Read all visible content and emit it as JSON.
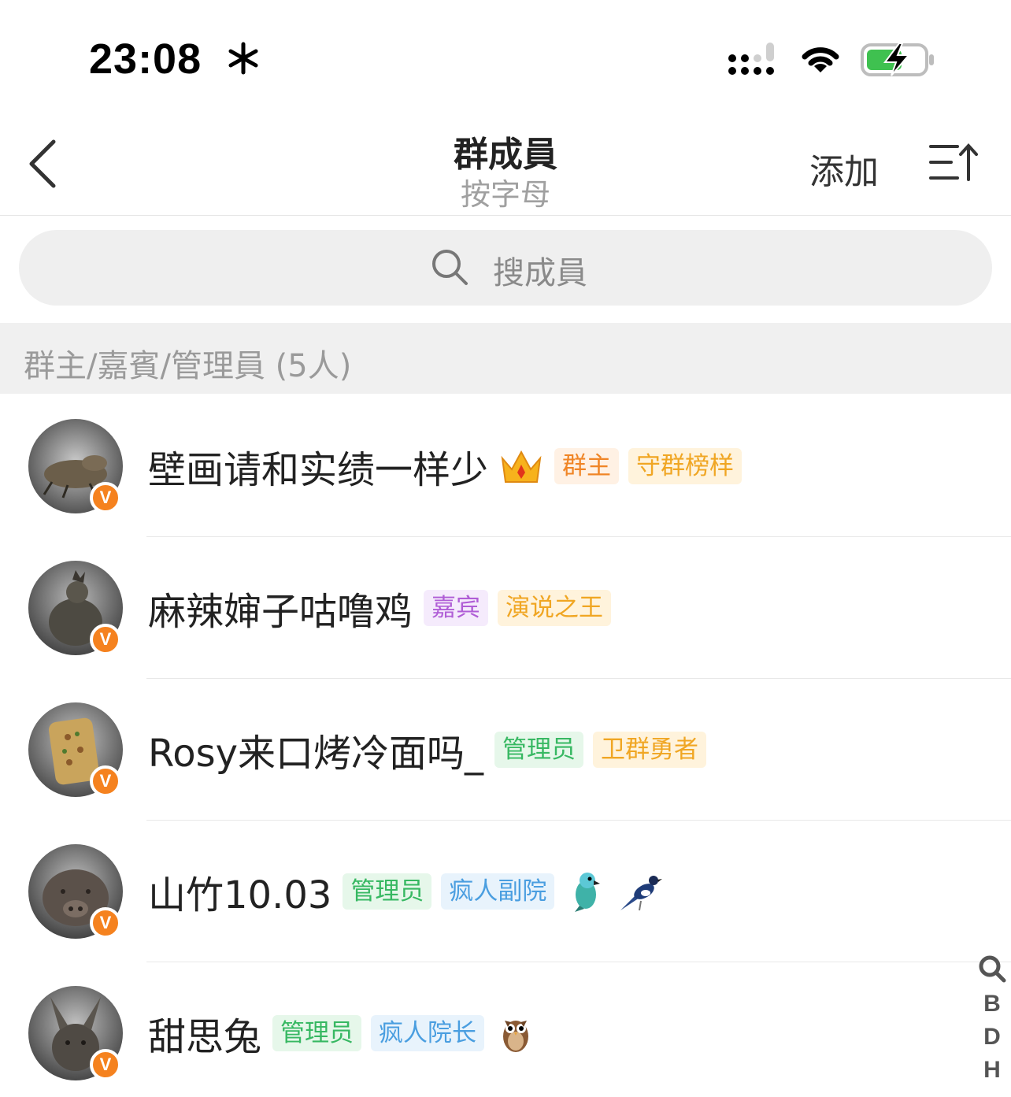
{
  "status_bar": {
    "time": "23:08"
  },
  "nav": {
    "title": "群成員",
    "subtitle": "按字母",
    "add_label": "添加"
  },
  "search": {
    "placeholder": "搜成員"
  },
  "section": {
    "title": "群主/嘉賓/管理員 (5人)"
  },
  "members": [
    {
      "name": "壁画请和实绩一样少",
      "tags": [
        "群主",
        "守群榜样"
      ],
      "icons": [
        "crown-icon"
      ]
    },
    {
      "name": "麻辣婶子咕噜鸡",
      "tags": [
        "嘉宾",
        "演说之王"
      ],
      "icons": []
    },
    {
      "name": "Rosy来口烤冷面吗_",
      "tags": [
        "管理员",
        "卫群勇者"
      ],
      "icons": []
    },
    {
      "name": "山竹10.03",
      "tags": [
        "管理员",
        "疯人副院"
      ],
      "icons": [
        "parrot-icon",
        "magpie-icon"
      ]
    },
    {
      "name": "甜思兔",
      "tags": [
        "管理员",
        "疯人院长"
      ],
      "icons": [
        "owl-icon"
      ]
    }
  ],
  "index_bar": [
    "B",
    "D",
    "H"
  ],
  "colors": {
    "accent_orange": "#f5821f",
    "admin_green": "#37b862",
    "guest_purple": "#b05ed6",
    "gold": "#f0a623"
  }
}
